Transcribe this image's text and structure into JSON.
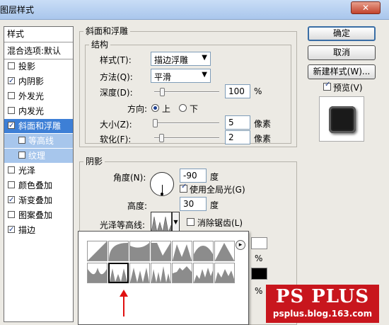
{
  "window": {
    "title": "图层样式",
    "close_glyph": "✕"
  },
  "left_panel": {
    "header": "样式",
    "blend_options": "混合选项:默认",
    "items": [
      {
        "label": "投影",
        "checked": false
      },
      {
        "label": "内阴影",
        "checked": true
      },
      {
        "label": "外发光",
        "checked": false
      },
      {
        "label": "内发光",
        "checked": false
      },
      {
        "label": "斜面和浮雕",
        "checked": true,
        "selected": true
      },
      {
        "label": "等高线",
        "checked": false,
        "sub": true
      },
      {
        "label": "纹理",
        "checked": false,
        "sub": true
      },
      {
        "label": "光泽",
        "checked": false
      },
      {
        "label": "颜色叠加",
        "checked": false
      },
      {
        "label": "渐变叠加",
        "checked": true
      },
      {
        "label": "图案叠加",
        "checked": false
      },
      {
        "label": "描边",
        "checked": true
      }
    ]
  },
  "bevel": {
    "section_title": "斜面和浮雕",
    "structure_title": "结构",
    "style_label": "样式(T):",
    "style_value": "描边浮雕",
    "technique_label": "方法(Q):",
    "technique_value": "平滑",
    "depth_label": "深度(D):",
    "depth_value": "100",
    "depth_unit": "%",
    "direction_label": "方向:",
    "direction_up": "上",
    "direction_down": "下",
    "size_label": "大小(Z):",
    "size_value": "5",
    "size_unit": "像素",
    "soften_label": "软化(F):",
    "soften_value": "2",
    "soften_unit": "像素"
  },
  "shading": {
    "title": "阴影",
    "angle_label": "角度(N):",
    "angle_value": "-90",
    "angle_unit": "度",
    "global_light_label": "使用全局光(G)",
    "global_light_checked": true,
    "altitude_label": "高度:",
    "altitude_value": "30",
    "altitude_unit": "度",
    "gloss_label": "光泽等高线:",
    "antialias_label": "消除锯齿(L)",
    "antialias_checked": false,
    "partial_percent_1": "%",
    "partial_percent_2": "%"
  },
  "buttons": {
    "ok": "确定",
    "cancel": "取消",
    "new_style": "新建样式(W)...",
    "preview": "预览(V)",
    "preview_checked": true
  },
  "contour_picker": {
    "menu_glyph": "▸",
    "selected_index": 7
  },
  "watermark": {
    "title": "PS PLUS",
    "url": "psplus.blog.163.com"
  },
  "colors": {
    "selection": "#3d7fd6",
    "subselection": "#a7c6ec",
    "arrow": "#e01010",
    "logo_bg": "#c8161d"
  }
}
